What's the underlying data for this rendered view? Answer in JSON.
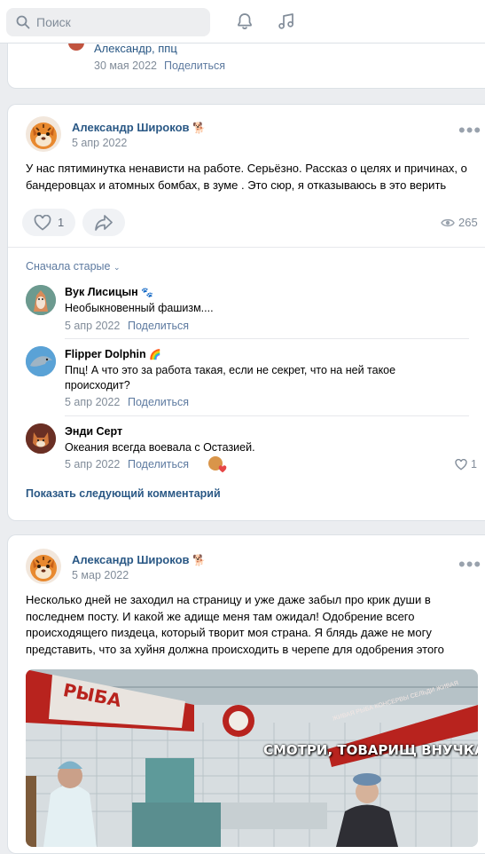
{
  "search": {
    "placeholder": "Поиск"
  },
  "icons": {
    "search": "search-icon",
    "bell": "bell-icon",
    "music": "music-note-icon",
    "more": "more-dots-icon",
    "like": "heart-icon",
    "share": "share-arrow-icon",
    "views": "eye-icon"
  },
  "colors": {
    "link": "#2a5885",
    "meta": "#818c99",
    "background": "#ebedf0",
    "accent_red": "#e64646"
  },
  "prev_post": {
    "author_line": "Александр, ппц",
    "date": "30 мая 2022",
    "share_label": "Поделиться"
  },
  "post1": {
    "author": "Александр Широков",
    "author_emoji": "🐕",
    "date": "5 апр 2022",
    "text": "У нас пятиминутка ненависти на работе. Серьёзно. Рассказ о целях и причинах, о бандеровцах и атомных бомбах, в зуме . Это сюр, я отказываюсь в это верить",
    "likes": "1",
    "views": "265",
    "sort_label": "Сначала старые",
    "comments": [
      {
        "name": "Вук Лисицын",
        "emoji": "🐾",
        "text": "Необыкновенный фашизм....",
        "date": "5 апр 2022",
        "share": "Поделиться"
      },
      {
        "name": "Flipper Dolphin",
        "emoji": "🌈",
        "text": "Ппц! А что это за работа такая, если не секрет, что на ней такое происходит?",
        "date": "5 апр 2022",
        "share": "Поделиться"
      },
      {
        "name": "Энди Серт",
        "emoji": "",
        "text": "Океания всегда воевала с Остазией.",
        "date": "5 апр 2022",
        "share": "Поделиться",
        "likes": "1"
      }
    ],
    "show_more": "Показать следующий комментарий"
  },
  "post2": {
    "author": "Александр Широков",
    "author_emoji": "🐕",
    "date": "5 мар 2022",
    "text": "Несколько дней не заходил на страницу и уже даже забыл про крик души в последнем посту. И какой же адище меня там ожидал! Одобрение всего происходящего пиздеца, который творит моя страна. Я блядь даже не могу представить, что за хуйня должна происходить в черепе для одобрения этого",
    "image": {
      "shop_sign": "РЫБА",
      "caption": "СМОТРИ, ТОВАРИЩ ВНУЧКА",
      "banner_text": "ЖИВАЯ РЫБА КОНСЕРВЫ СЕЛЬДИ ЖИВАЯ"
    }
  }
}
